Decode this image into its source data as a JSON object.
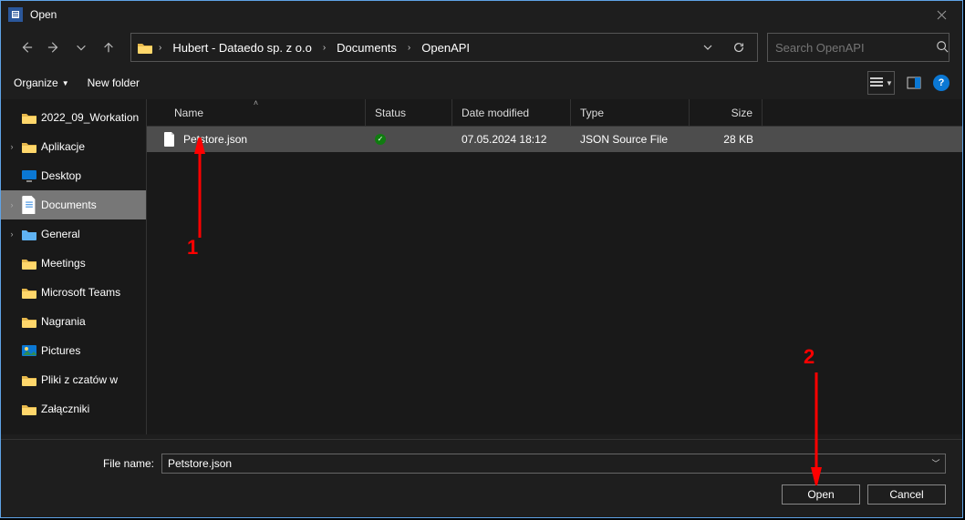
{
  "titlebar": {
    "title": "Open"
  },
  "breadcrumb": {
    "segments": [
      "Hubert - Dataedo sp. z o.o",
      "Documents",
      "OpenAPI"
    ]
  },
  "search": {
    "placeholder": "Search OpenAPI"
  },
  "toolbar": {
    "organize": "Organize",
    "newfolder": "New folder"
  },
  "tree": {
    "items": [
      {
        "label": "2022_09_Workation",
        "icon": "folder",
        "expandable": false
      },
      {
        "label": "Aplikacje",
        "icon": "folder",
        "expandable": true
      },
      {
        "label": "Desktop",
        "icon": "monitor",
        "expandable": false
      },
      {
        "label": "Documents",
        "icon": "doc",
        "expandable": true,
        "selected": true
      },
      {
        "label": "General",
        "icon": "general",
        "expandable": true
      },
      {
        "label": "Meetings",
        "icon": "folder",
        "expandable": false
      },
      {
        "label": "Microsoft Teams",
        "icon": "folder",
        "expandable": false
      },
      {
        "label": "Nagrania",
        "icon": "folder",
        "expandable": false
      },
      {
        "label": "Pictures",
        "icon": "pictures",
        "expandable": false
      },
      {
        "label": "Pliki z czatów w",
        "icon": "folder",
        "expandable": false
      },
      {
        "label": "Załączniki",
        "icon": "folder",
        "expandable": false
      }
    ]
  },
  "columns": {
    "name": "Name",
    "status": "Status",
    "date": "Date modified",
    "type": "Type",
    "size": "Size"
  },
  "files": [
    {
      "name": "Petstore.json",
      "status": "synced",
      "date": "07.05.2024 18:12",
      "type": "JSON Source File",
      "size": "28 KB"
    }
  ],
  "footer": {
    "filename_label": "File name:",
    "filename_value": "Petstore.json",
    "open": "Open",
    "cancel": "Cancel"
  },
  "annotations": {
    "one": "1",
    "two": "2"
  }
}
